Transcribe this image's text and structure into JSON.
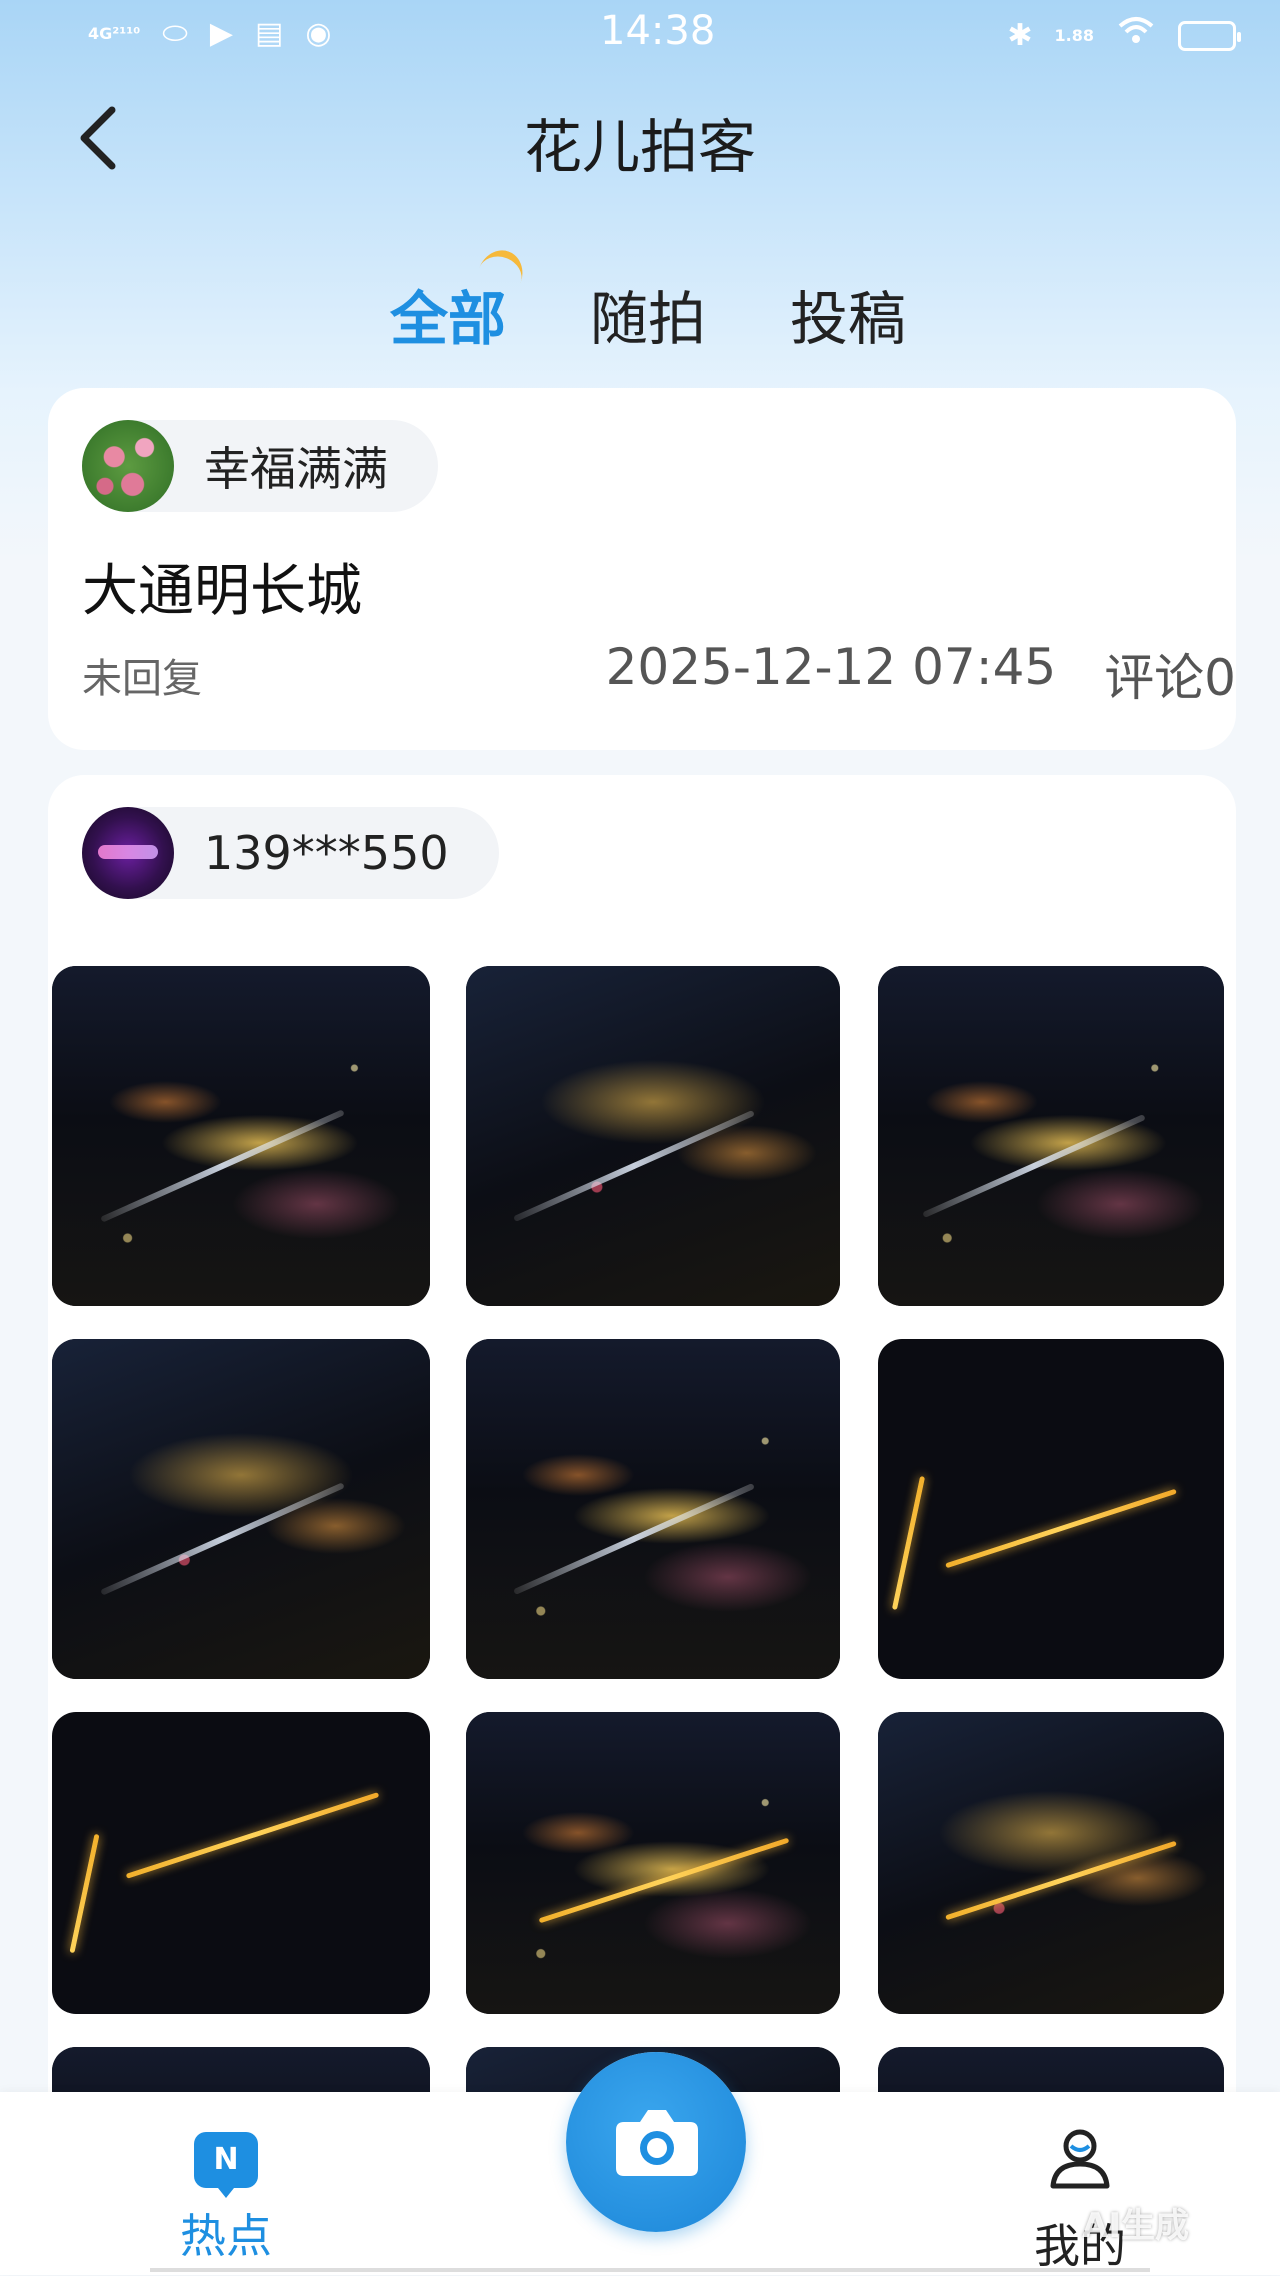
{
  "status_bar": {
    "time": "14:38",
    "network": "4G²¹¹⁰",
    "speed": "1.88"
  },
  "header": {
    "title": "花儿拍客"
  },
  "tabs": [
    {
      "label": "全部",
      "active": true
    },
    {
      "label": "随拍",
      "active": false
    },
    {
      "label": "投稿",
      "active": false
    }
  ],
  "posts": [
    {
      "user": "幸福满满",
      "avatar": "flower-avatar",
      "title": "大通明长城",
      "status": "未回复",
      "date": "2025-12-12 07:45",
      "comments": "评论0"
    },
    {
      "user": "139***550",
      "avatar": "night-avatar",
      "photo_count_visible": 12
    }
  ],
  "bottom_nav": {
    "hot_label": "热点",
    "hot_icon_text": "N",
    "mine_label": "我的",
    "camera": "camera-icon"
  },
  "watermark": "AI生成",
  "colors": {
    "accent": "#1e8fe1",
    "tab_arc": "#f6b93b",
    "header_gradient_top": "#a9d5f6"
  }
}
